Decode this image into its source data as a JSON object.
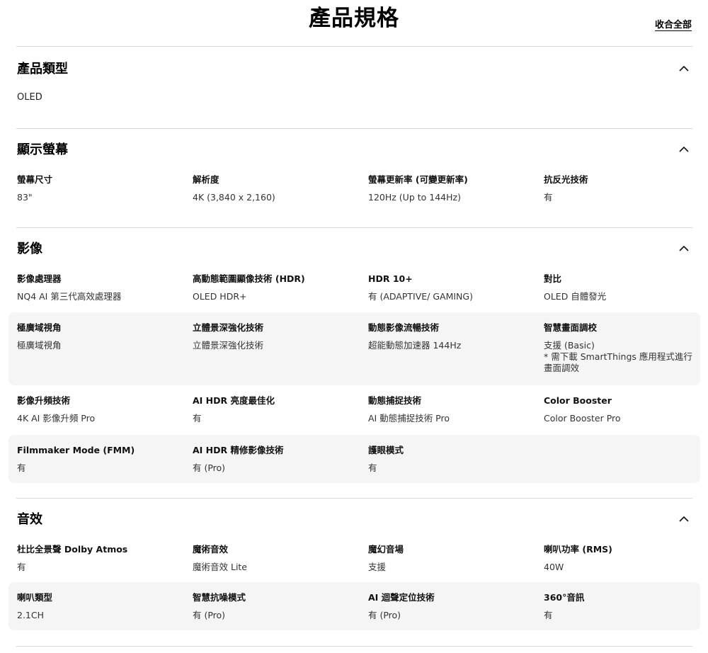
{
  "header": {
    "title": "產品規格",
    "collapse_all": "收合全部"
  },
  "sections": [
    {
      "title": "產品類型",
      "value": "OLED"
    },
    {
      "title": "顯示螢幕",
      "rows": [
        [
          {
            "label": "螢幕尺寸",
            "value": "83\""
          },
          {
            "label": "解析度",
            "value": "4K (3,840 x 2,160)"
          },
          {
            "label": "螢幕更新率 (可變更新率)",
            "value": "120Hz (Up to 144Hz)"
          },
          {
            "label": "抗反光技術",
            "value": "有"
          }
        ]
      ]
    },
    {
      "title": "影像",
      "rows": [
        [
          {
            "label": "影像處理器",
            "value": "NQ4 AI 第三代高效處理器"
          },
          {
            "label": "高動態範圍顯像技術 (HDR)",
            "value": "OLED HDR+"
          },
          {
            "label": "HDR 10+",
            "value": "有 (ADAPTIVE/ GAMING)"
          },
          {
            "label": "對比",
            "value": "OLED 自體發光"
          }
        ],
        [
          {
            "label": "極廣域視角",
            "value": "極廣域視角"
          },
          {
            "label": "立體景深強化技術",
            "value": "立體景深強化技術"
          },
          {
            "label": "動態影像流暢技術",
            "value": "超能動態加速器 144Hz"
          },
          {
            "label": "智慧畫面調校",
            "value": "支援 (Basic)\n* 需下載 SmartThings 應用程式進行\n畫面調效"
          }
        ],
        [
          {
            "label": "影像升頻技術",
            "value": "4K AI 影像升頻 Pro"
          },
          {
            "label": "AI HDR 亮度最佳化",
            "value": "有"
          },
          {
            "label": "動態捕捉技術",
            "value": "AI 動態捕捉技術 Pro"
          },
          {
            "label": "Color Booster",
            "value": "Color Booster Pro"
          }
        ],
        [
          {
            "label": "Filmmaker Mode (FMM)",
            "value": "有"
          },
          {
            "label": "AI HDR 精修影像技術",
            "value": "有 (Pro)"
          },
          {
            "label": "護眼模式",
            "value": "有"
          }
        ]
      ]
    },
    {
      "title": "音效",
      "rows": [
        [
          {
            "label": "杜比全景聲 Dolby Atmos",
            "value": "有"
          },
          {
            "label": "魔術音效",
            "value": "魔術音效 Lite"
          },
          {
            "label": "魔幻音場",
            "value": "支援"
          },
          {
            "label": "喇叭功率 (RMS)",
            "value": "40W"
          }
        ],
        [
          {
            "label": "喇叭類型",
            "value": "2.1CH"
          },
          {
            "label": "智慧抗噪模式",
            "value": "有 (Pro)"
          },
          {
            "label": "AI 迴聲定位技術",
            "value": "有 (Pro)"
          },
          {
            "label": "360°音訊",
            "value": "有"
          }
        ]
      ]
    }
  ]
}
